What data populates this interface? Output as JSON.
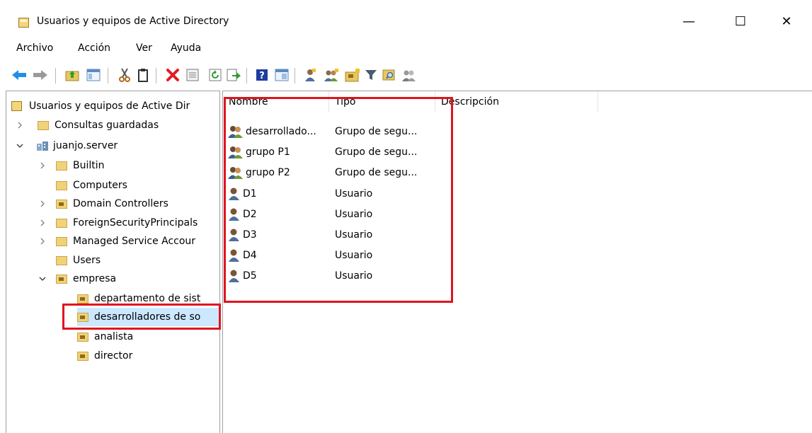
{
  "window": {
    "title": "Usuarios y equipos de Active Directory",
    "controls": {
      "minimize": "—",
      "maximize": "☐",
      "close": "✕"
    }
  },
  "menu": [
    "Archivo",
    "Acción",
    "Ver",
    "Ayuda"
  ],
  "toolbar": [
    "back-arrow-icon",
    "forward-arrow-icon",
    "up-folder-icon",
    "show-hide-tree-icon",
    "cut-icon",
    "copy-icon",
    "delete-icon",
    "properties-icon",
    "refresh-icon",
    "export-list-icon",
    "help-icon",
    "details-view-icon",
    "new-user-icon",
    "new-group-icon",
    "new-ou-icon",
    "filter-icon",
    "find-icon",
    "add-to-group-icon"
  ],
  "tree": {
    "root": "Usuarios y equipos de Active Dir",
    "items": [
      {
        "label": "Consultas guardadas"
      },
      {
        "label": "juanjo.server"
      },
      {
        "label": "Builtin"
      },
      {
        "label": "Computers"
      },
      {
        "label": "Domain Controllers"
      },
      {
        "label": "ForeignSecurityPrincipals"
      },
      {
        "label": "Managed Service Accour"
      },
      {
        "label": "Users"
      },
      {
        "label": "empresa"
      },
      {
        "label": "departamento de sist"
      },
      {
        "label": "desarrolladores de so"
      },
      {
        "label": "analista"
      },
      {
        "label": "director"
      }
    ]
  },
  "list": {
    "columns": [
      "Nombre",
      "Tipo",
      "Descripción"
    ],
    "rows": [
      {
        "name": "desarrollado...",
        "type": "Grupo de segu...",
        "kind": "group"
      },
      {
        "name": "grupo P1",
        "type": "Grupo de segu...",
        "kind": "group"
      },
      {
        "name": "grupo P2",
        "type": "Grupo de segu...",
        "kind": "group"
      },
      {
        "name": "D1",
        "type": "Usuario",
        "kind": "user"
      },
      {
        "name": "D2",
        "type": "Usuario",
        "kind": "user"
      },
      {
        "name": "D3",
        "type": "Usuario",
        "kind": "user"
      },
      {
        "name": "D4",
        "type": "Usuario",
        "kind": "user"
      },
      {
        "name": "D5",
        "type": "Usuario",
        "kind": "user"
      }
    ]
  },
  "colors": {
    "highlight": "#e0141e",
    "folder": "#f0d27a"
  }
}
